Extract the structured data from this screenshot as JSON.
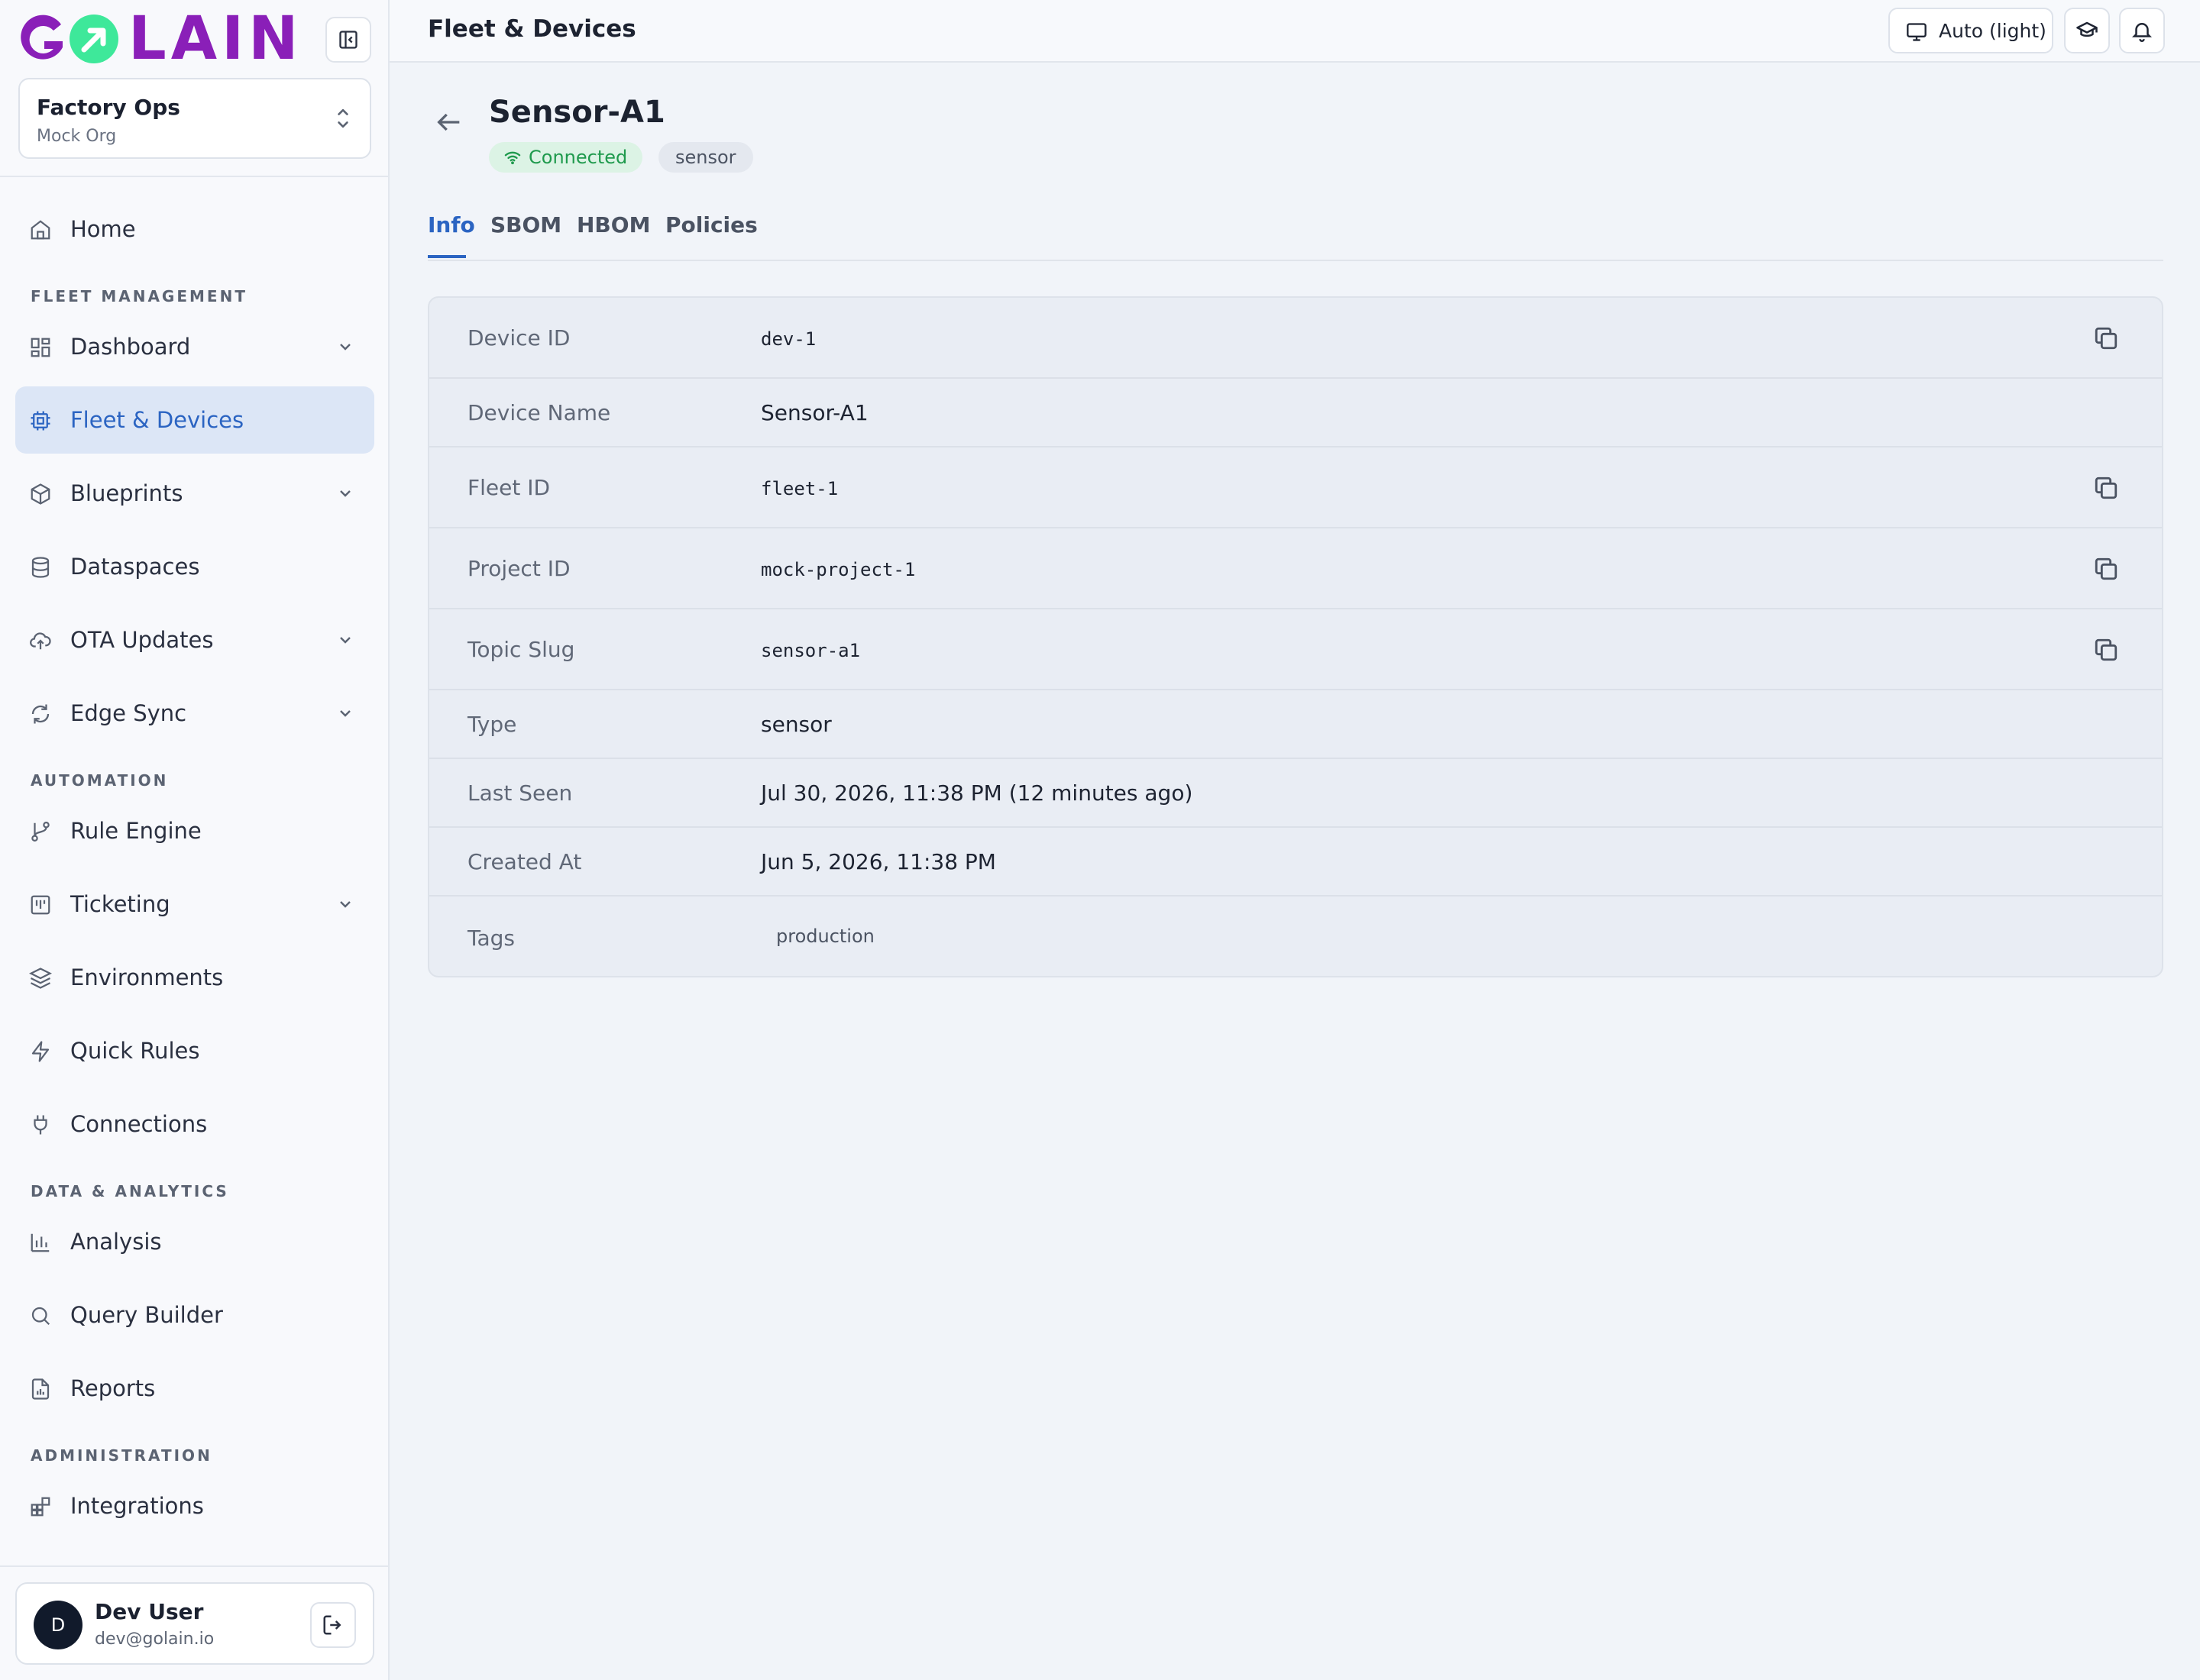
{
  "brand": {
    "logo_text": "GOLAIN",
    "primary_color": "#8a1fb8",
    "accent_color": "#3ee89a"
  },
  "org": {
    "name": "Factory Ops",
    "subtitle": "Mock Org"
  },
  "sidebar": {
    "home": "Home",
    "sections": {
      "fleet": "FLEET MANAGEMENT",
      "automation": "AUTOMATION",
      "analytics": "DATA & ANALYTICS",
      "admin": "ADMINISTRATION"
    },
    "items": {
      "dashboard": "Dashboard",
      "fleet_devices": "Fleet & Devices",
      "blueprints": "Blueprints",
      "dataspaces": "Dataspaces",
      "ota_updates": "OTA Updates",
      "edge_sync": "Edge Sync",
      "rule_engine": "Rule Engine",
      "ticketing": "Ticketing",
      "environments": "Environments",
      "quick_rules": "Quick Rules",
      "connections": "Connections",
      "analysis": "Analysis",
      "query_builder": "Query Builder",
      "reports": "Reports",
      "integrations": "Integrations"
    },
    "active": "Fleet & Devices",
    "active_color": "#2b64c2"
  },
  "user": {
    "initial": "D",
    "name": "Dev User",
    "email": "dev@golain.io"
  },
  "topbar": {
    "title": "Fleet & Devices",
    "theme_label": "Auto (light)"
  },
  "device": {
    "title": "Sensor-A1",
    "status": "Connected",
    "status_color": "#1f9a4d",
    "type_badge": "sensor"
  },
  "tabs": [
    "Info",
    "SBOM",
    "HBOM",
    "Policies"
  ],
  "active_tab": "Info",
  "info": {
    "device_id": {
      "label": "Device ID",
      "value": "dev-1"
    },
    "device_name": {
      "label": "Device Name",
      "value": "Sensor-A1"
    },
    "fleet_id": {
      "label": "Fleet ID",
      "value": "fleet-1"
    },
    "project_id": {
      "label": "Project ID",
      "value": "mock-project-1"
    },
    "topic_slug": {
      "label": "Topic Slug",
      "value": "sensor-a1"
    },
    "type": {
      "label": "Type",
      "value": "sensor"
    },
    "last_seen": {
      "label": "Last Seen",
      "value": "Jul 30, 2026, 11:38 PM (12 minutes ago)"
    },
    "created_at": {
      "label": "Created At",
      "value": "Jun 5, 2026, 11:38 PM"
    },
    "tags": {
      "label": "Tags",
      "value": "production"
    }
  },
  "icons": {
    "collapse": "sidebar-collapse-icon",
    "theme": "monitor-icon",
    "learn": "graduation-cap-icon",
    "notifications": "bell-icon",
    "copy": "copy-icon",
    "back": "arrow-left-icon"
  }
}
